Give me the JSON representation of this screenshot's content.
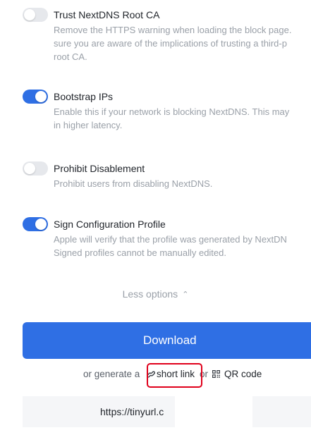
{
  "settings": [
    {
      "title": "Trust NextDNS Root CA",
      "description": "Remove the HTTPS warning when loading the block page.\nsure you are aware of the implications of trusting a third-p\nroot CA.",
      "enabled": false
    },
    {
      "title": "Bootstrap IPs",
      "description": "Enable this if your network is blocking NextDNS. This may\nin higher latency.",
      "enabled": true
    },
    {
      "title": "Prohibit Disablement",
      "description": "Prohibit users from disabling NextDNS.",
      "enabled": false
    },
    {
      "title": "Sign Configuration Profile",
      "description": "Apple will verify that the profile was generated by NextDN\nSigned profiles cannot be manually edited.",
      "enabled": true
    }
  ],
  "less_options": {
    "label": "Less options",
    "icon": "chevron-up-icon"
  },
  "download": {
    "label": "Download"
  },
  "generate": {
    "prefix": "or generate a",
    "short_link_label": "short link",
    "short_link_icon": "link-icon",
    "or": "or",
    "qr_label": "QR code",
    "qr_icon": "qr-code-icon"
  },
  "url_field": {
    "value": "https://tinyurl.c"
  },
  "colors": {
    "accent": "#2f6fe4",
    "highlight": "#e0001b",
    "muted_text": "#9aa0a8",
    "toggle_off": "#e6e8ec"
  }
}
